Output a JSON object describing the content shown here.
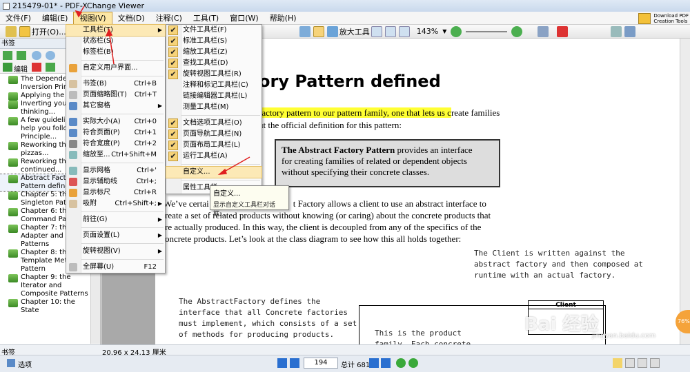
{
  "window": {
    "title": "215479-01* - PDF-XChange Viewer",
    "minimize": "–",
    "maximize": "□",
    "close": "✕"
  },
  "menubar": {
    "items": [
      "文件(F)",
      "编辑(E)",
      "视图(V)",
      "文档(D)",
      "注释(C)",
      "工具(T)",
      "窗口(W)",
      "帮助(H)"
    ],
    "active_index": 2
  },
  "promo": {
    "line1": "Download PDF",
    "line2": "Creation Tools"
  },
  "toolbar": {
    "open_label": "打开(O)...",
    "zoom_tool_label": "放大工具",
    "zoom_value": "143%"
  },
  "left_panel": {
    "title": "书签",
    "edit_label": "编辑",
    "bookmarks": [
      [
        "The Dependency",
        "Inversion Princi..."
      ],
      [
        "Applying the Pr..."
      ],
      [
        "Inverting your",
        "thinking..."
      ],
      [
        "A few guideline",
        "help you follow",
        "Principle..."
      ],
      [
        "Reworking the",
        "pizzas..."
      ],
      [
        "Reworking the",
        "continued..."
      ],
      [
        "Abstract Facto",
        "Pattern    define"
      ],
      [
        "Chapter 5: the",
        "Singleton Patte"
      ],
      [
        "Chapter 6: the",
        "Command Patte"
      ],
      [
        "Chapter 7: the",
        "Adapter and Fa",
        "Patterns"
      ],
      [
        "Chapter 8: the",
        "Template Method",
        "Pattern"
      ],
      [
        "Chapter 9: the",
        "Iterator and",
        "Composite Patterns"
      ],
      [
        "Chapter 10: the State"
      ]
    ],
    "selected_index": 6
  },
  "view_menu": {
    "rows": [
      {
        "label": "工具栏(T)",
        "shortcut": "",
        "submenu": true,
        "highlight": true
      },
      {
        "label": "状态栏(S)",
        "shortcut": ""
      },
      {
        "label": "标签栏(B)",
        "shortcut": ""
      },
      {
        "sep": true
      },
      {
        "label": "自定义用户界面...",
        "shortcut": ""
      },
      {
        "sep": true
      },
      {
        "label": "书签(B)",
        "shortcut": "Ctrl+B"
      },
      {
        "label": "页面缩略图(T)",
        "shortcut": "Ctrl+T"
      },
      {
        "label": "其它窗格",
        "shortcut": "",
        "submenu": true
      },
      {
        "sep": true
      },
      {
        "label": "实际大小(A)",
        "shortcut": "Ctrl+0"
      },
      {
        "label": "符合页面(P)",
        "shortcut": "Ctrl+1"
      },
      {
        "label": "符合宽度(P)",
        "shortcut": "Ctrl+2"
      },
      {
        "label": "缩放至...",
        "shortcut": "Ctrl+Shift+M"
      },
      {
        "sep": true
      },
      {
        "label": "显示网格",
        "shortcut": "Ctrl+'"
      },
      {
        "label": "显示辅助线",
        "shortcut": "Ctrl+;"
      },
      {
        "label": "显示标尺",
        "shortcut": "Ctrl+R"
      },
      {
        "label": "吸附",
        "shortcut": "Ctrl+Shift+;",
        "submenu": true
      },
      {
        "sep": true
      },
      {
        "label": "前往(G)",
        "shortcut": "",
        "submenu": true
      },
      {
        "sep": true
      },
      {
        "label": "页面设置(L)",
        "shortcut": "",
        "submenu": true
      },
      {
        "sep": true
      },
      {
        "label": "旋转视图(V)",
        "shortcut": "",
        "submenu": true
      },
      {
        "sep": true
      },
      {
        "label": "全屏幕(U)",
        "shortcut": "F12"
      }
    ]
  },
  "toolbar_submenu": {
    "rows": [
      {
        "label": "文件工具栏(F)",
        "checked": true
      },
      {
        "label": "标准工具栏(S)",
        "checked": true
      },
      {
        "label": "缩放工具栏(Z)",
        "checked": true
      },
      {
        "label": "查找工具栏(D)",
        "checked": true
      },
      {
        "label": "旋转视图工具栏(R)",
        "checked": true
      },
      {
        "label": "注释和标记工具栏(C)",
        "checked": false
      },
      {
        "label": "链接编辑器工具栏(L)",
        "checked": false
      },
      {
        "label": "测量工具栏(M)",
        "checked": false
      },
      {
        "sep": true
      },
      {
        "label": "文档选项工具栏(O)",
        "checked": true
      },
      {
        "label": "页面导航工具栏(N)",
        "checked": true
      },
      {
        "label": "页面布局工具栏(L)",
        "checked": true
      },
      {
        "label": "运行工具栏(A)",
        "checked": true
      },
      {
        "sep": true
      },
      {
        "label": "自定义...",
        "checked": false,
        "highlight": true
      },
      {
        "sep": true
      },
      {
        "label": "属性工具栏",
        "checked": false
      }
    ]
  },
  "tooltip_menu": {
    "title": "自定义...",
    "desc": "显示自定义工具栏对话框..."
  },
  "document": {
    "heading": "ory Pattern defined",
    "line1_pre": "",
    "line1_hl": "factory pattern to our pattern family, one that lets us c",
    "line1_post": "reate families",
    "line2": "ut the official definition for this pattern:",
    "def_bold": "The Abstract Factory Pattern",
    "def_rest1": " provides an interface",
    "def_line2": "for creating families of related or dependent objects",
    "def_line3": "without specifying their concrete classes.",
    "para1": "We’ve certai",
    "para1b": "t Factory allows a client to use an abstract interface to",
    "para2": "reate a set of related products without knowing (or caring) about the concrete products that",
    "para3": "re actually produced.  In this way, the client is decoupled from any of the specifics of the",
    "para4": "oncrete products.  Let’s look at the class diagram to see how this all holds together:",
    "note_right": [
      "The Client is written against the",
      "abstract factory and then composed at",
      "runtime with an actual factory."
    ],
    "note_left": [
      "The AbstractFactory defines the",
      "interface that all Concrete factories",
      "must implement, which consists of a set",
      "of methods for producing products."
    ],
    "note_mid": [
      "This is the product",
      "family. Each concrete"
    ],
    "client_label": "Client"
  },
  "statusbar": {
    "tab_label": "书签",
    "dimensions": "20.96 x 24.13 厘米",
    "options_label": "选项",
    "page_current": "194",
    "page_total": "总计 681"
  },
  "watermark": {
    "brand": "Bai 经验",
    "site": "jingyan.baidu.com",
    "badge": "76%"
  },
  "colors": {
    "menu_highlight": "#fce9b6",
    "text_highlight": "#ffff33",
    "annotation_arrow": "#e02020"
  }
}
